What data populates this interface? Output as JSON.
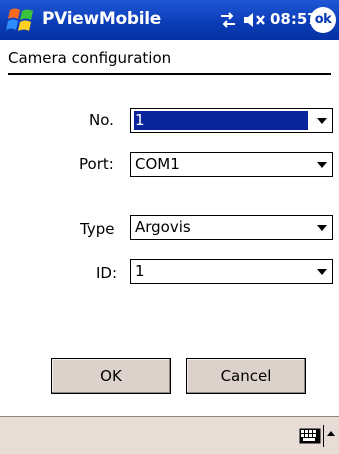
{
  "titlebar": {
    "app_title": "PViewMobile",
    "time": "08:57",
    "ok_label": "ok"
  },
  "page": {
    "title": "Camera configuration"
  },
  "form": {
    "no": {
      "label": "No.",
      "value": "1"
    },
    "port": {
      "label": "Port:",
      "value": "COM1"
    },
    "type": {
      "label": "Type",
      "value": "Argovis"
    },
    "id": {
      "label": "ID:",
      "value": "1"
    }
  },
  "buttons": {
    "ok": "OK",
    "cancel": "Cancel"
  },
  "colors": {
    "title_bar": "#0a3bb5",
    "selection": "#0a249c",
    "button_face": "#ddd1cc",
    "menubar": "#e8dcd7"
  },
  "icons": {
    "start": "windows-flag-icon",
    "connection": "connectivity-icon",
    "volume": "speaker-muted-icon",
    "keyboard": "keyboard-icon",
    "input_arrow": "chevron-up-icon"
  }
}
